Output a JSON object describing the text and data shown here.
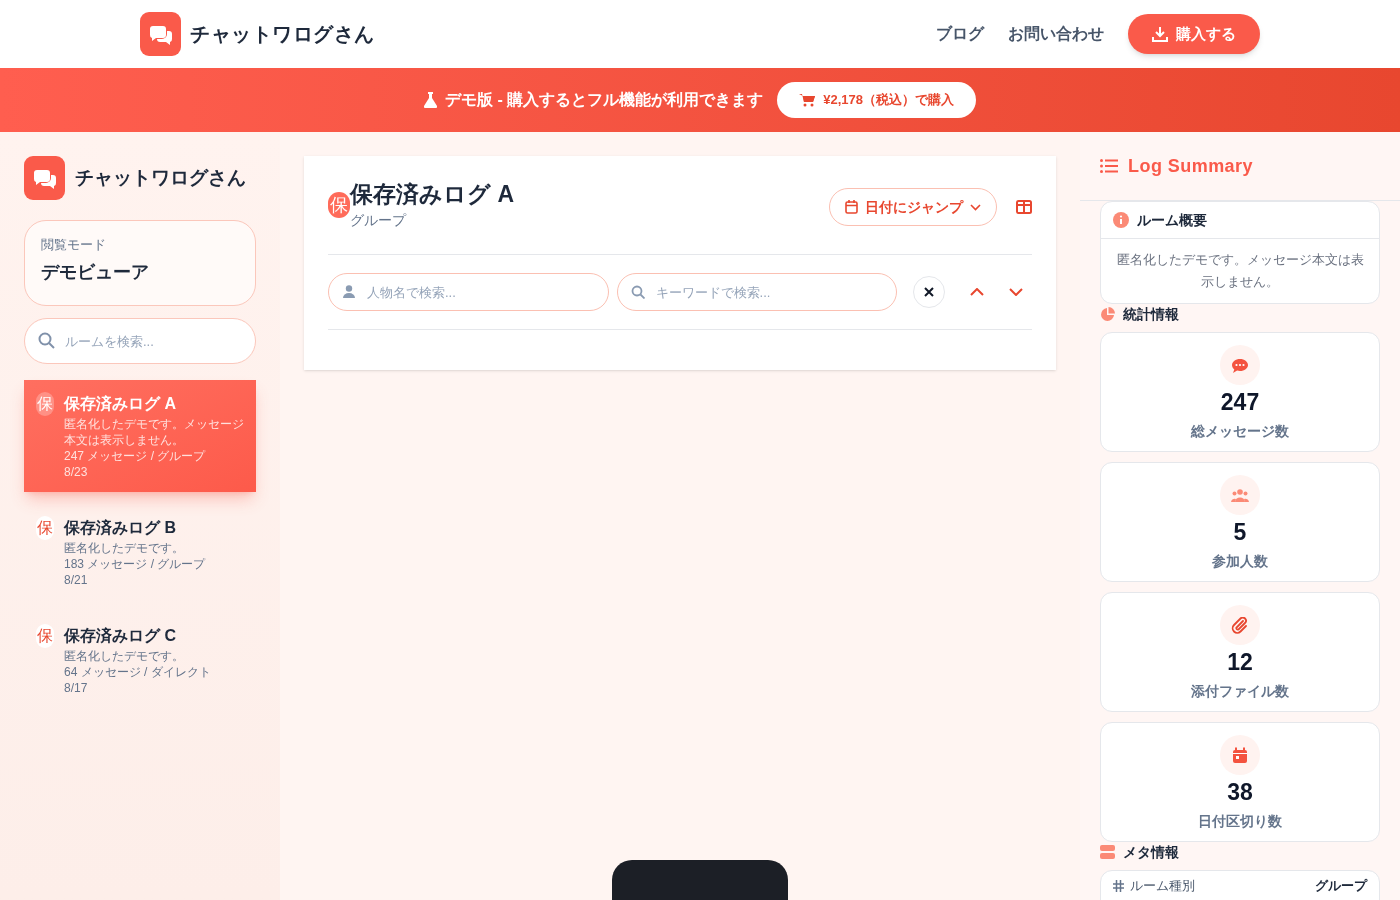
{
  "header": {
    "logo_text": "チャットワログさん",
    "nav": [
      "ブログ",
      "お問い合わせ"
    ],
    "buy_button": "購入する"
  },
  "banner": {
    "text": "デモ版 - 購入するとフル機能が利用できます",
    "button": "¥2,178（税込）で購入"
  },
  "sidebar": {
    "app_name": "チャットワログさん",
    "mode": {
      "label": "閲覧モード",
      "value": "デモビューア"
    },
    "search": {
      "placeholder": "ルームを検索..."
    },
    "rooms": [
      {
        "badge": "保",
        "title": "保存済みログ A",
        "description": "匿名化したデモです。メッセージ本文は表示しません。",
        "meta": "247 メッセージ / グループ",
        "date": "8/23",
        "selected": true
      },
      {
        "badge": "保",
        "title": "保存済みログ B",
        "description": "匿名化したデモです。",
        "meta": "183 メッセージ / グループ",
        "date": "8/21",
        "selected": false
      },
      {
        "badge": "保",
        "title": "保存済みログ C",
        "description": "匿名化したデモです。",
        "meta": "64 メッセージ / ダイレクト",
        "date": "8/17",
        "selected": false
      }
    ]
  },
  "room": {
    "badge": "保",
    "title": "保存済みログ A",
    "subtitle": "グループ",
    "date_jump_button": "日付にジャンプ",
    "person_search": {
      "placeholder": "人物名で検索..."
    },
    "keyword_search": {
      "placeholder": "キーワードで検索..."
    }
  },
  "summary": {
    "title": "Log Summary",
    "overview": {
      "heading": "ルーム概要",
      "text": "匿名化したデモです。メッセージ本文は表示しません。"
    },
    "stats_heading": "統計情報",
    "stats": [
      {
        "kind": "messages",
        "value": "247",
        "label": "総メッセージ数"
      },
      {
        "kind": "people",
        "value": "5",
        "label": "参加人数"
      },
      {
        "kind": "attachments",
        "value": "12",
        "label": "添付ファイル数"
      },
      {
        "kind": "dates",
        "value": "38",
        "label": "日付区切り数"
      }
    ],
    "meta_heading": "メタ情報",
    "meta_rows": [
      {
        "label": "ルーム種別",
        "value": "グループ"
      }
    ]
  }
}
